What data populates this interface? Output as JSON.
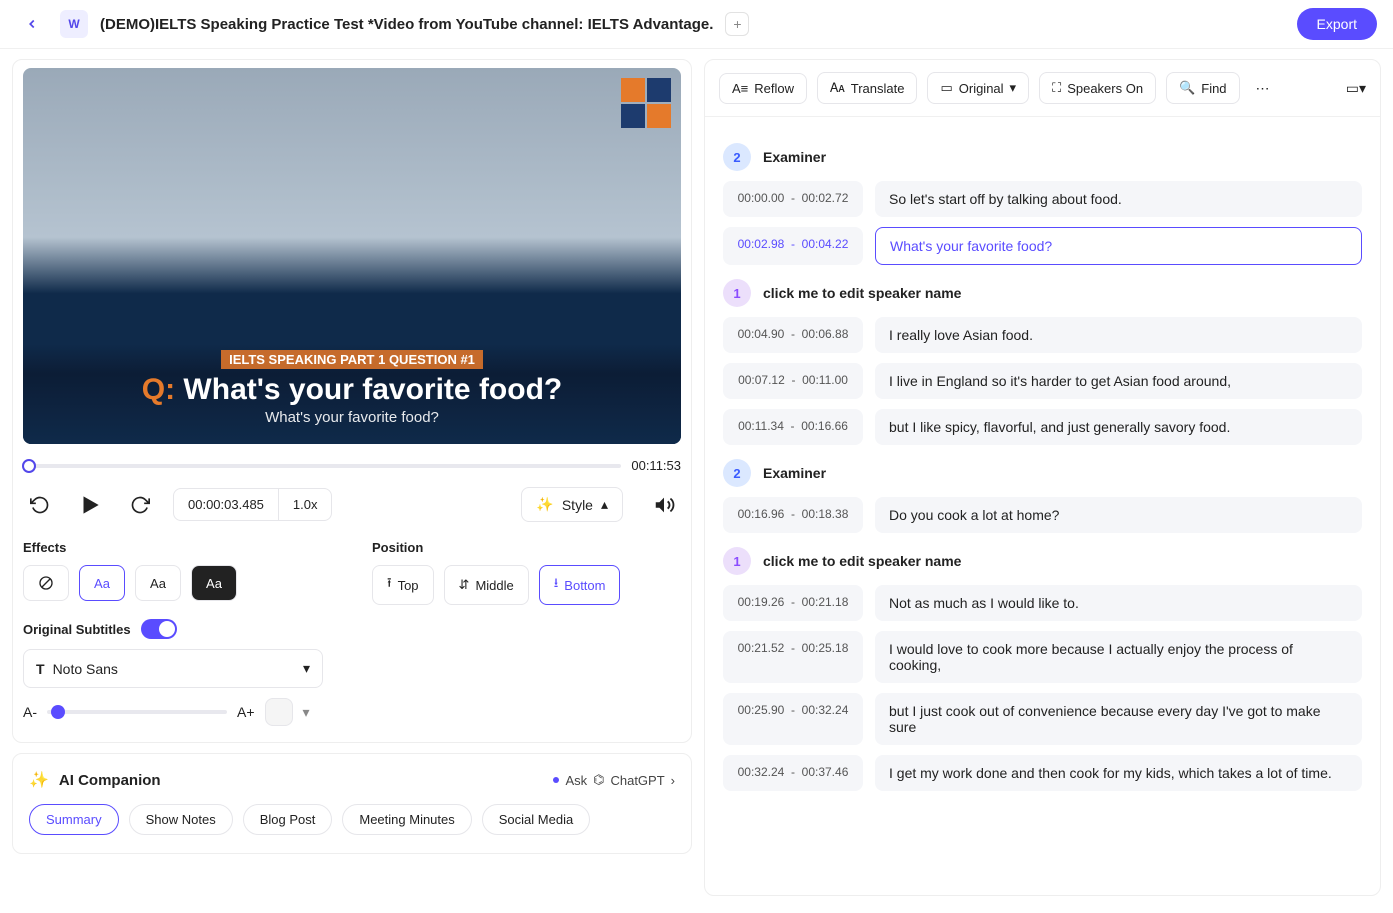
{
  "header": {
    "title": "(DEMO)IELTS Speaking Practice Test *Video from YouTube channel: IELTS Advantage.",
    "export": "Export"
  },
  "player": {
    "pill": "IELTS SPEAKING PART 1 QUESTION #1",
    "question": "What's your favorite food?",
    "sub_small": "What's your favorite food?",
    "duration": "00:11:53",
    "current_time": "00:00:03.485",
    "rate": "1.0x",
    "style_label": "Style"
  },
  "effects": {
    "label": "Effects",
    "items": [
      "none",
      "Aa",
      "Aa",
      "Aa"
    ]
  },
  "position": {
    "label": "Position",
    "top": "Top",
    "middle": "Middle",
    "bottom": "Bottom"
  },
  "subs": {
    "label": "Original Subtitles",
    "font": "Noto Sans",
    "A_minus": "A-",
    "A_plus": "A+"
  },
  "ai": {
    "title": "AI Companion",
    "ask": "Ask",
    "gpt": "ChatGPT",
    "chips": [
      "Summary",
      "Show Notes",
      "Blog Post",
      "Meeting Minutes",
      "Social Media"
    ]
  },
  "toolbar": {
    "reflow": "Reflow",
    "translate": "Translate",
    "original": "Original",
    "speakers": "Speakers On",
    "find": "Find"
  },
  "transcript": [
    {
      "type": "speaker",
      "id": "2",
      "name": "Examiner"
    },
    {
      "type": "line",
      "ts": "00:00.00 - 00:02.72",
      "text": "So let's start off by talking about food.",
      "active": false
    },
    {
      "type": "line",
      "ts": "00:02.98 - 00:04.22",
      "text": "What's your favorite food?",
      "active": true
    },
    {
      "type": "speaker",
      "id": "1",
      "name": "click me to edit speaker name"
    },
    {
      "type": "line",
      "ts": "00:04.90 - 00:06.88",
      "text": "I really love Asian food.",
      "active": false
    },
    {
      "type": "line",
      "ts": "00:07.12 - 00:11.00",
      "text": "I live in England so it's harder to get Asian food around,",
      "active": false
    },
    {
      "type": "line",
      "ts": "00:11.34 - 00:16.66",
      "text": "but I like spicy, flavorful, and just generally savory food.",
      "active": false
    },
    {
      "type": "speaker",
      "id": "2",
      "name": "Examiner"
    },
    {
      "type": "line",
      "ts": "00:16.96 - 00:18.38",
      "text": "Do you cook a lot at home?",
      "active": false
    },
    {
      "type": "speaker",
      "id": "1",
      "name": "click me to edit speaker name"
    },
    {
      "type": "line",
      "ts": "00:19.26 - 00:21.18",
      "text": "Not as much as I would like to.",
      "active": false
    },
    {
      "type": "line",
      "ts": "00:21.52 - 00:25.18",
      "text": "I would love to cook more because I actually enjoy the process of cooking,",
      "active": false
    },
    {
      "type": "line",
      "ts": "00:25.90 - 00:32.24",
      "text": "but I just cook out of convenience because every day I've got to make sure",
      "active": false
    },
    {
      "type": "line",
      "ts": "00:32.24 - 00:37.46",
      "text": "I get my work done and then cook for my kids, which takes a lot of time.",
      "active": false
    }
  ]
}
